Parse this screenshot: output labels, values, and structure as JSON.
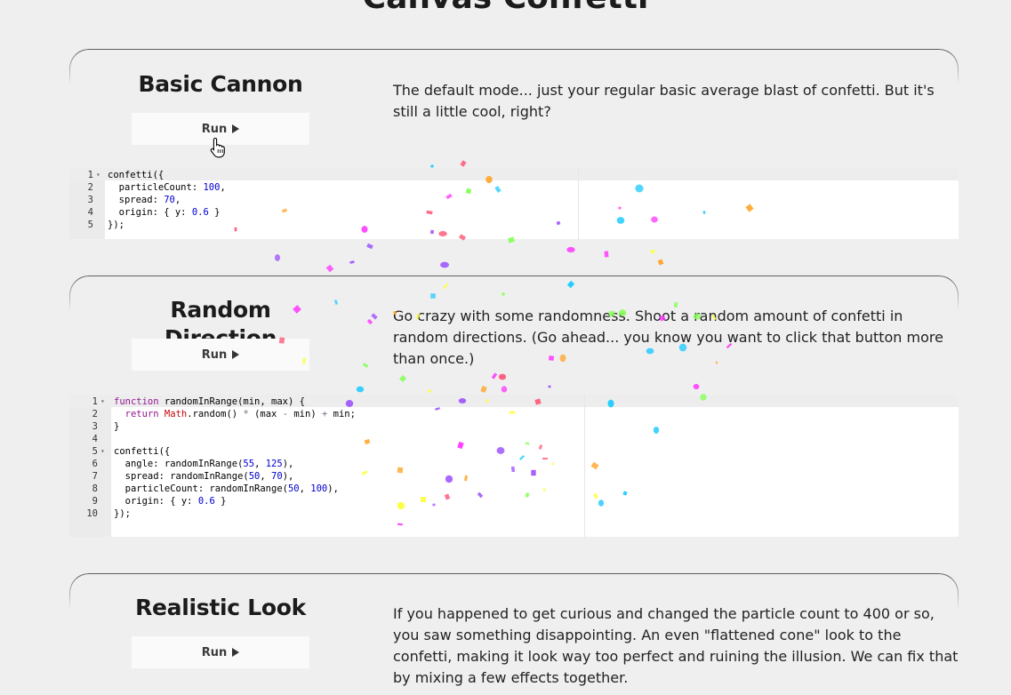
{
  "page": {
    "title": "Canvas Confetti"
  },
  "sections": [
    {
      "title": "Basic Cannon",
      "run_label": "Run",
      "description": "The default mode... just your regular basic average blast of confetti. But it's still a little cool, right?",
      "code": [
        {
          "n": "1",
          "text": "confetti({"
        },
        {
          "n": "2",
          "text": "  particleCount: 100,"
        },
        {
          "n": "3",
          "text": "  spread: 70,"
        },
        {
          "n": "4",
          "text": "  origin: { y: 0.6 }"
        },
        {
          "n": "5",
          "text": "});"
        }
      ]
    },
    {
      "title": "Random Direction",
      "run_label": "Run",
      "description": "Go crazy with some randomness. Shoot a random amount of confetti in random directions. (Go ahead... you know you want to click that button more than once.)",
      "code": [
        {
          "n": "1",
          "text": "function randomInRange(min, max) {"
        },
        {
          "n": "2",
          "text": "  return Math.random() * (max - min) + min;"
        },
        {
          "n": "3",
          "text": "}"
        },
        {
          "n": "4",
          "text": ""
        },
        {
          "n": "5",
          "text": "confetti({"
        },
        {
          "n": "6",
          "text": "  angle: randomInRange(55, 125),"
        },
        {
          "n": "7",
          "text": "  spread: randomInRange(50, 70),"
        },
        {
          "n": "8",
          "text": "  particleCount: randomInRange(50, 100),"
        },
        {
          "n": "9",
          "text": "  origin: { y: 0.6 }"
        },
        {
          "n": "10",
          "text": "});"
        }
      ]
    },
    {
      "title": "Realistic Look",
      "run_label": "Run",
      "description": "If you happened to get curious and changed the particle count to 400 or so, you saw something disappointing. An even \"flattened cone\" look to the confetti, making it look way too perfect and ruining the illusion. We can fix that by mixing a few effects together."
    }
  ],
  "confetti_colors": [
    "#26ccff",
    "#a25afd",
    "#ff5e7e",
    "#88ff5a",
    "#fcff42",
    "#ffa62d",
    "#ff36ff"
  ]
}
